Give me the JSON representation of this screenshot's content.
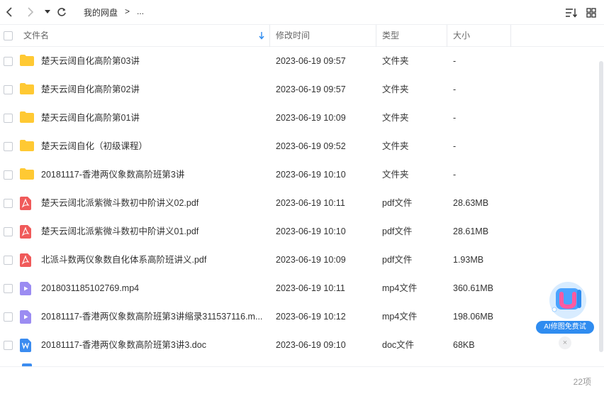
{
  "toolbar": {
    "breadcrumb_root": "我的网盘",
    "breadcrumb_sep": ">",
    "breadcrumb_more": "..."
  },
  "columns": {
    "name": "文件名",
    "modified": "修改时间",
    "type": "类型",
    "size": "大小"
  },
  "colors": {
    "folder": "#ffc933",
    "pdf": "#f05a5a",
    "video": "#9b8cf2",
    "doc": "#3b8cf0",
    "sort_arrow": "#2f8cf0"
  },
  "files": [
    {
      "name": "楚天云阔自化高阶第03讲",
      "modified": "2023-06-19 09:57",
      "type": "文件夹",
      "size": "-",
      "icon": "folder-icon"
    },
    {
      "name": "楚天云阔自化高阶第02讲",
      "modified": "2023-06-19 09:57",
      "type": "文件夹",
      "size": "-",
      "icon": "folder-icon"
    },
    {
      "name": "楚天云阔自化高阶第01讲",
      "modified": "2023-06-19 10:09",
      "type": "文件夹",
      "size": "-",
      "icon": "folder-icon"
    },
    {
      "name": "楚天云阔自化（初级课程）",
      "modified": "2023-06-19 09:52",
      "type": "文件夹",
      "size": "-",
      "icon": "folder-icon"
    },
    {
      "name": "20181117-香港两仪象数高阶班第3讲",
      "modified": "2023-06-19 10:10",
      "type": "文件夹",
      "size": "-",
      "icon": "folder-icon"
    },
    {
      "name": "楚天云阔北派紫微斗数初中阶讲义02.pdf",
      "modified": "2023-06-19 10:11",
      "type": "pdf文件",
      "size": "28.63MB",
      "icon": "pdf-icon"
    },
    {
      "name": "楚天云阔北派紫微斗数初中阶讲义01.pdf",
      "modified": "2023-06-19 10:10",
      "type": "pdf文件",
      "size": "28.61MB",
      "icon": "pdf-icon"
    },
    {
      "name": "北派斗数两仪象数自化体系高阶班讲义.pdf",
      "modified": "2023-06-19 10:09",
      "type": "pdf文件",
      "size": "1.93MB",
      "icon": "pdf-icon"
    },
    {
      "name": "2018031185102769.mp4",
      "modified": "2023-06-19 10:11",
      "type": "mp4文件",
      "size": "360.61MB",
      "icon": "video-icon"
    },
    {
      "name": "20181117-香港两仪象数高阶班第3讲缩录311537116.m...",
      "modified": "2023-06-19 10:12",
      "type": "mp4文件",
      "size": "198.06MB",
      "icon": "video-icon"
    },
    {
      "name": "20181117-香港两仪象数高阶班第3讲3.doc",
      "modified": "2023-06-19 09:10",
      "type": "doc文件",
      "size": "68KB",
      "icon": "doc-icon"
    }
  ],
  "footer": {
    "count": "22项"
  },
  "ai_widget": {
    "label": "AI修图免费试",
    "close": "×"
  }
}
